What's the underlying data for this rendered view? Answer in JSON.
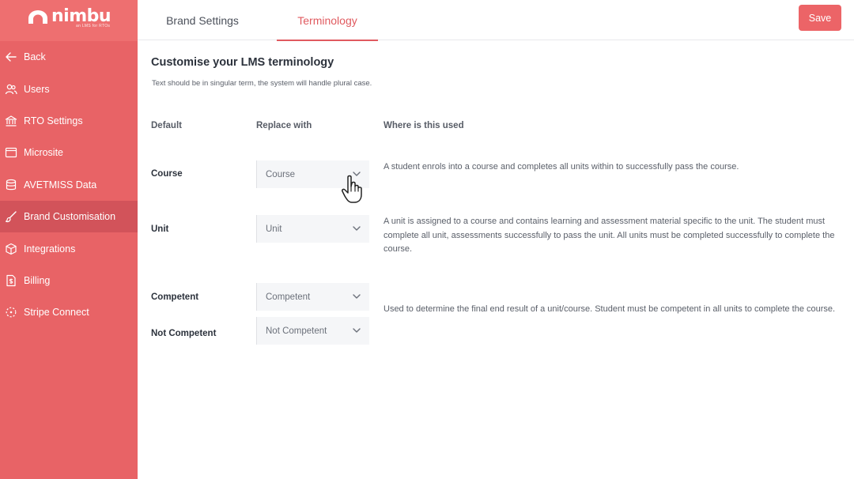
{
  "brand": {
    "name": "nimbu",
    "subtitle": "an LMS for RTOs",
    "colors": {
      "sidebar": "#e86366",
      "active_item": "#d2535a",
      "accent": "#e05a5f",
      "save_button": "#ec6467"
    }
  },
  "sidebar": {
    "items": [
      {
        "label": "Back",
        "icon": "arrow-left-icon"
      },
      {
        "label": "Users",
        "icon": "users-icon"
      },
      {
        "label": "RTO Settings",
        "icon": "bank-icon"
      },
      {
        "label": "Microsite",
        "icon": "browser-window-icon"
      },
      {
        "label": "AVETMISS Data",
        "icon": "database-icon"
      },
      {
        "label": "Brand Customisation",
        "icon": "brush-icon",
        "active": true
      },
      {
        "label": "Integrations",
        "icon": "cube-icon"
      },
      {
        "label": "Billing",
        "icon": "invoice-icon"
      },
      {
        "label": "Stripe Connect",
        "icon": "connect-icon"
      }
    ]
  },
  "tabs": [
    {
      "label": "Brand Settings",
      "active": false
    },
    {
      "label": "Terminology",
      "active": true
    }
  ],
  "toolbar": {
    "save_label": "Save"
  },
  "page": {
    "title": "Customise your LMS terminology",
    "subtitle": "Text should be in singular term, the system will handle plural case."
  },
  "columns": {
    "default": "Default",
    "replace": "Replace with",
    "where": "Where is this used"
  },
  "rows": [
    {
      "default": "Course",
      "value": "Course",
      "description": "A student enrols into a course and completes all units within to successfully pass the course."
    },
    {
      "default": "Unit",
      "value": "Unit",
      "description": "A unit is assigned to a course and contains learning and assessment material specific to the unit. The student must complete all unit, assessments successfully to pass the unit. All units must be completed successfully to complete the course."
    },
    {
      "default": "Competent",
      "value": "Competent"
    },
    {
      "default": "Not Competent",
      "value": "Not Competent"
    }
  ],
  "competency_description": "Used to determine the final end result of a unit/course. Student must be competent in all units to complete the course."
}
